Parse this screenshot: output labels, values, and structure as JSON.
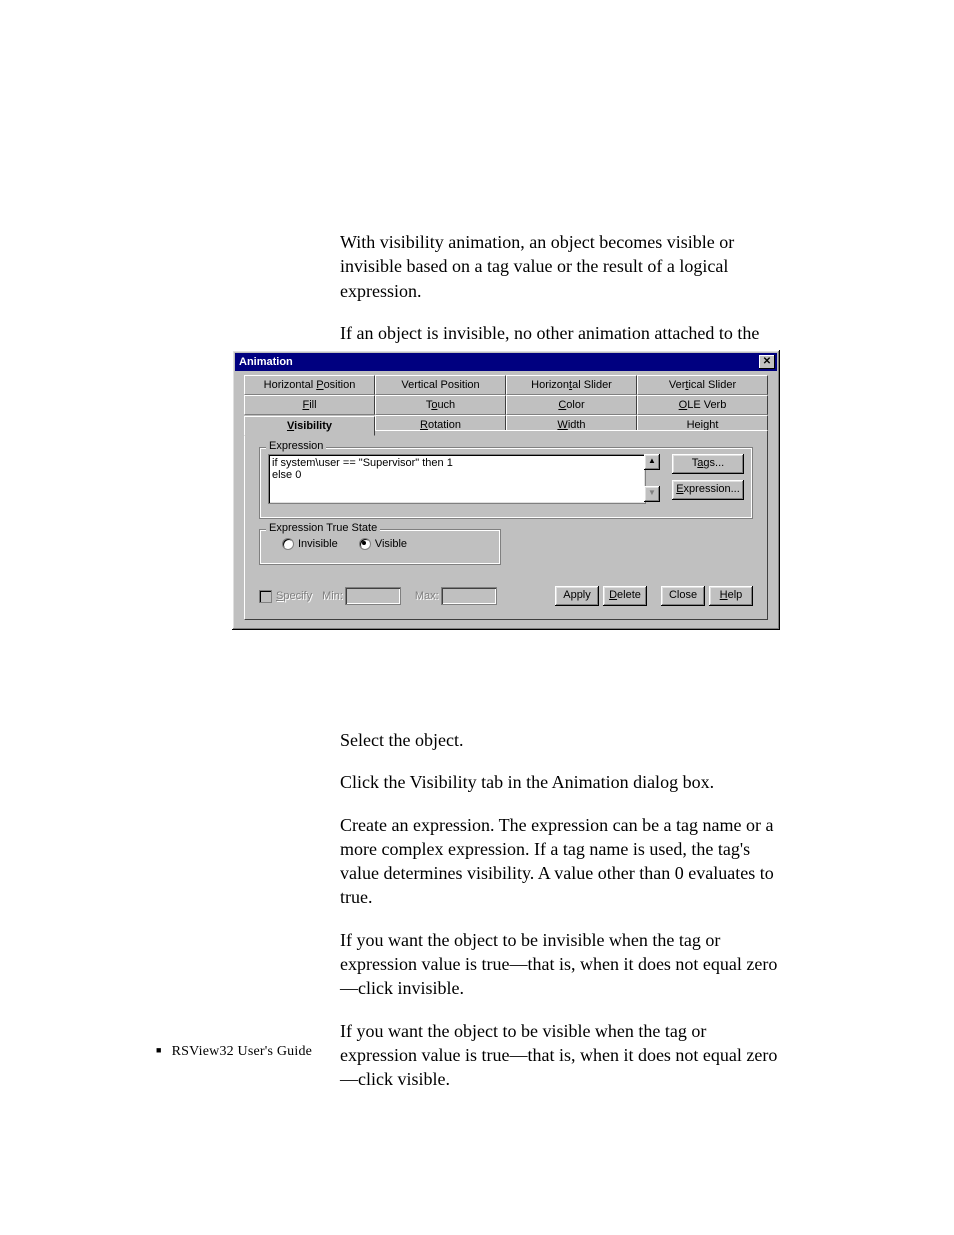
{
  "intro": {
    "p1": "With visibility animation, an object becomes visible or invisible based on a tag value or the result of a logical expression.",
    "p2": "If an object is invisible, no other animation attached to the object is evaluated to prevent unnecessary processing."
  },
  "dialog": {
    "title": "Animation",
    "close_glyph": "✕",
    "tabs_row1": [
      "Horizontal Position",
      "Vertical Position",
      "Horizontal Slider",
      "Vertical Slider"
    ],
    "tabs_row1_underline": [
      "P",
      "",
      "t",
      "t"
    ],
    "tabs_row2": [
      "Fill",
      "Touch",
      "Color",
      "OLE Verb"
    ],
    "tabs_row2_underline": [
      "F",
      "o",
      "C",
      "O"
    ],
    "tabs_row3": [
      "Visibility",
      "Rotation",
      "Width",
      "Height"
    ],
    "tabs_row3_underline": [
      "V",
      "R",
      "W",
      ""
    ],
    "active_tab": "Visibility",
    "group_expression": "Expression",
    "expression_text": "if system\\user == \"Supervisor\" then 1\nelse 0",
    "btn_tags": "Tags...",
    "btn_expression": "Expression...",
    "group_true_state": "Expression True State",
    "radio_invisible": "Invisible",
    "radio_visible": "Visible",
    "radio_selected": "Visible",
    "chk_specify": "Specify",
    "lbl_min": "Min:",
    "lbl_max": "Max:",
    "btn_apply": "Apply",
    "btn_delete": "Delete",
    "btn_close": "Close",
    "btn_help": "Help"
  },
  "steps": {
    "s1": "Select the object.",
    "s2": "Click the Visibility tab in the Animation dialog box.",
    "s3": "Create an expression. The expression can be a tag name or a more complex expression. If a tag name is used, the tag's value determines visibility. A value other than 0 evaluates to true.",
    "s4": "If you want the object to be invisible when the tag or expression value is true—that is, when it does not equal zero—click invisible.",
    "s5": "If you want the object to be visible when the tag or expression value is true—that is, when it does not equal zero—click visible."
  },
  "footer": {
    "text": "RSView32  User's Guide"
  }
}
